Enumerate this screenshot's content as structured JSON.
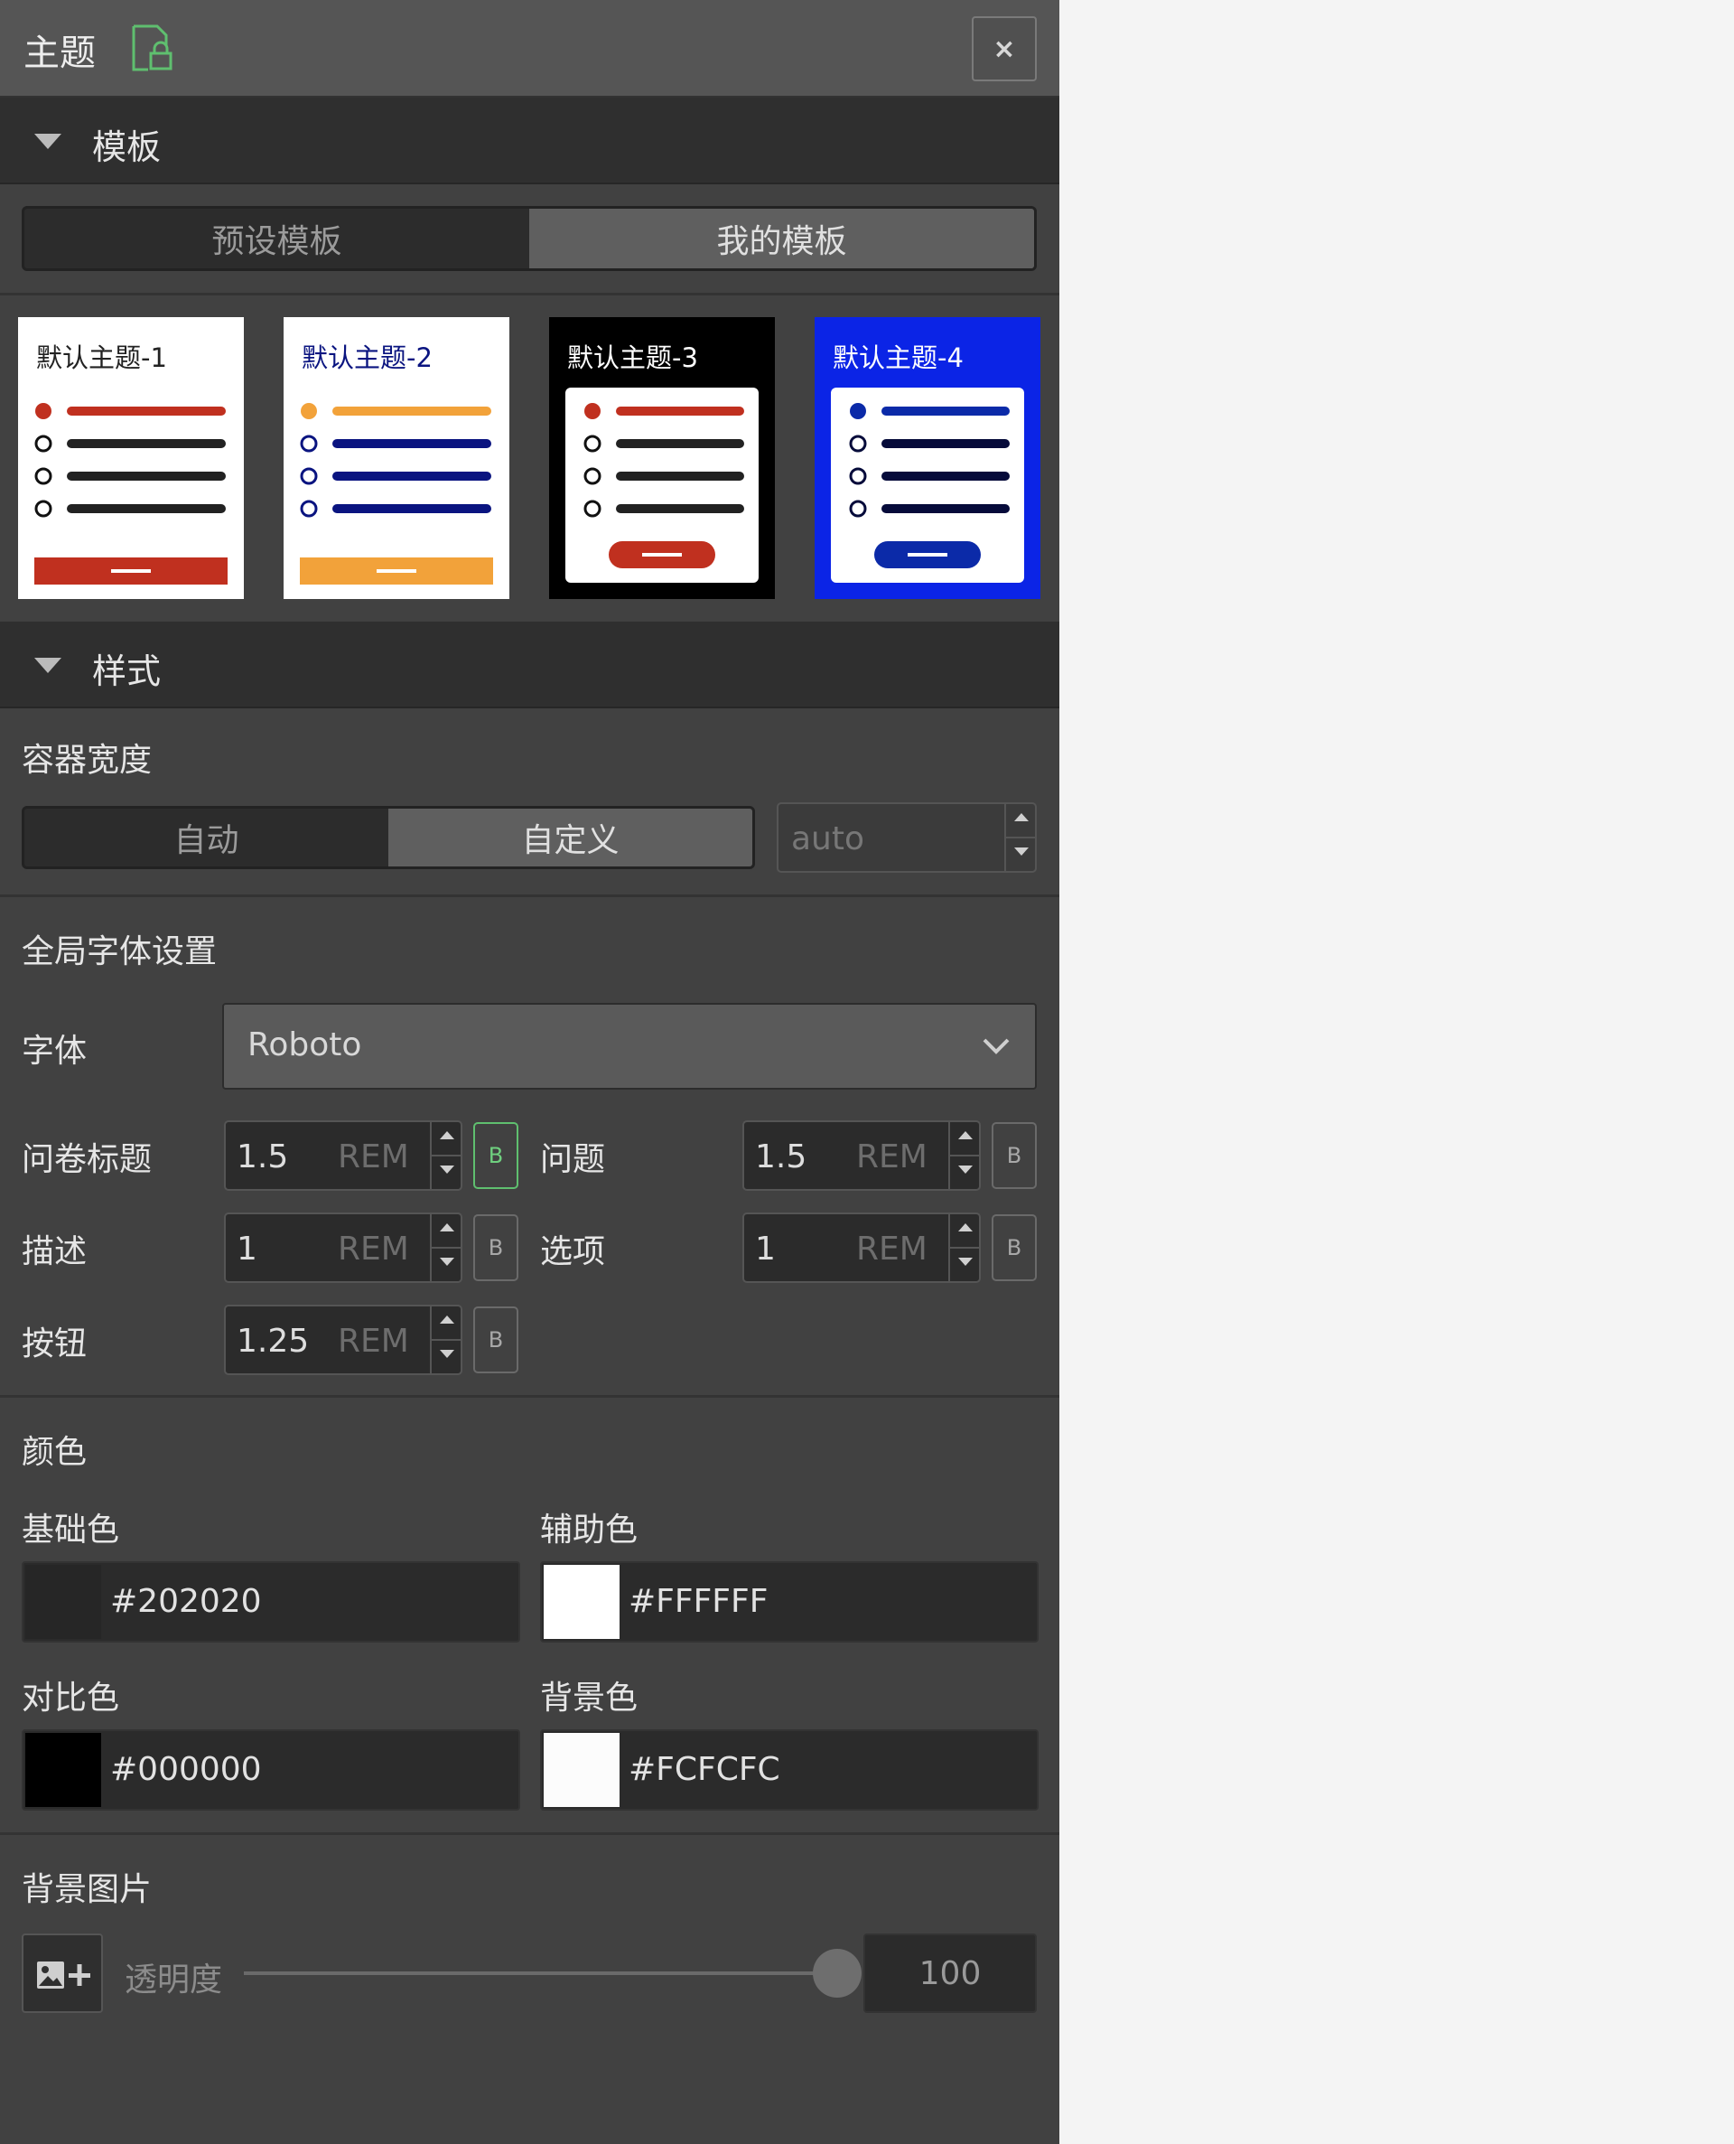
{
  "header": {
    "title": "主题",
    "close_label": "×"
  },
  "template_section": {
    "label": "模板",
    "tabs": [
      {
        "label": "预设模板",
        "active": false
      },
      {
        "label": "我的模板",
        "active": true
      }
    ],
    "themes": [
      {
        "name": "默认主题-1",
        "bg": "#ffffff",
        "title_color": "#222222",
        "accent": "#c0301f",
        "line": "#222222"
      },
      {
        "name": "默认主题-2",
        "bg": "#ffffff",
        "title_color": "#0a1480",
        "accent": "#f2a23a",
        "line": "#0a1480"
      },
      {
        "name": "默认主题-3",
        "bg": "#000000",
        "title_color": "#ffffff",
        "accent": "#c0301f",
        "line": "#222222"
      },
      {
        "name": "默认主题-4",
        "bg": "#0b24e6",
        "title_color": "#ffffff",
        "accent": "#0b2aa8",
        "line": "#060b3a"
      }
    ]
  },
  "style_section": {
    "label": "样式",
    "container_width": {
      "label": "容器宽度",
      "options": [
        {
          "label": "自动",
          "active": false
        },
        {
          "label": "自定义",
          "active": true
        }
      ],
      "input_value": "auto"
    },
    "global_font": {
      "label": "全局字体设置",
      "font_label": "字体",
      "font_value": "Roboto",
      "unit": "REM",
      "bold_label": "B",
      "sizes": {
        "title": {
          "label": "问卷标题",
          "value": "1.5",
          "bold": true
        },
        "question": {
          "label": "问题",
          "value": "1.5",
          "bold": false
        },
        "description": {
          "label": "描述",
          "value": "1",
          "bold": false
        },
        "option": {
          "label": "选项",
          "value": "1",
          "bold": false
        },
        "button": {
          "label": "按钮",
          "value": "1.25",
          "bold": false
        }
      }
    },
    "colors": {
      "label": "颜色",
      "base": {
        "label": "基础色",
        "hex": "#202020"
      },
      "secondary": {
        "label": "辅助色",
        "hex": "#FFFFFF"
      },
      "contrast": {
        "label": "对比色",
        "hex": "#000000"
      },
      "background": {
        "label": "背景色",
        "hex": "#FCFCFC"
      }
    },
    "background_image": {
      "label": "背景图片",
      "opacity_label": "透明度",
      "opacity_value": "100",
      "opacity_fraction": 1.0
    }
  }
}
